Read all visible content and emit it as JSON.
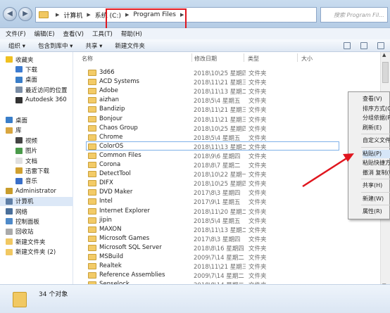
{
  "address": {
    "nav_back": "◀",
    "nav_fwd": "▶",
    "crumbs": [
      "计算机",
      "系统 (C:)",
      "Program Files"
    ],
    "search_placeholder": "搜索 Program Fil..."
  },
  "menubar": [
    "文件(F)",
    "编辑(E)",
    "查看(V)",
    "工具(T)",
    "帮助(H)"
  ],
  "toolbar": [
    "组织 ▾",
    "包含到库中 ▾",
    "共享 ▾",
    "新建文件夹"
  ],
  "sidebar": [
    {
      "label": "收藏夹",
      "icon": "star-icon",
      "indent": 1
    },
    {
      "label": "下载",
      "icon": "download-icon",
      "indent": 2
    },
    {
      "label": "桌面",
      "icon": "desktop-icon",
      "indent": 2
    },
    {
      "label": "最近访问的位置",
      "icon": "recent-icon",
      "indent": 2
    },
    {
      "label": "Autodesk 360",
      "icon": "cloud-icon",
      "indent": 2
    },
    {
      "label": "",
      "icon": "",
      "indent": 0
    },
    {
      "label": "桌面",
      "icon": "desktop-icon",
      "indent": 1
    },
    {
      "label": "库",
      "icon": "library-icon",
      "indent": 1
    },
    {
      "label": "视频",
      "icon": "video-icon",
      "indent": 2
    },
    {
      "label": "图片",
      "icon": "picture-icon",
      "indent": 2
    },
    {
      "label": "文档",
      "icon": "document-icon",
      "indent": 2
    },
    {
      "label": "迅雷下载",
      "icon": "thunder-icon",
      "indent": 2
    },
    {
      "label": "音乐",
      "icon": "music-icon",
      "indent": 2
    },
    {
      "label": "Administrator",
      "icon": "user-icon",
      "indent": 1
    },
    {
      "label": "计算机",
      "icon": "computer-icon",
      "indent": 1
    },
    {
      "label": "网络",
      "icon": "network-icon",
      "indent": 1
    },
    {
      "label": "控制面板",
      "icon": "control-panel-icon",
      "indent": 1
    },
    {
      "label": "回收站",
      "icon": "recycle-bin-icon",
      "indent": 1
    },
    {
      "label": "新建文件夹",
      "icon": "folder-icon",
      "indent": 1
    },
    {
      "label": "新建文件夹 (2)",
      "icon": "folder-icon",
      "indent": 1
    }
  ],
  "sidebar_selected": 14,
  "columns": [
    "名称",
    "修改日期",
    "类型",
    "大小"
  ],
  "files": [
    {
      "name": "3d66",
      "date": "2018\\10\\25 星期四",
      "type": "文件夹"
    },
    {
      "name": "ACD Systems",
      "date": "2018\\11\\21 星期三",
      "type": "文件夹"
    },
    {
      "name": "Adobe",
      "date": "2018\\11\\13 星期二",
      "type": "文件夹"
    },
    {
      "name": "aizhan",
      "date": "2018\\5\\4 星期五",
      "type": "文件夹"
    },
    {
      "name": "Bandizip",
      "date": "2018\\11\\21 星期三",
      "type": "文件夹"
    },
    {
      "name": "Bonjour",
      "date": "2018\\11\\21 星期三",
      "type": "文件夹"
    },
    {
      "name": "Chaos Group",
      "date": "2018\\10\\25 星期四",
      "type": "文件夹"
    },
    {
      "name": "Chrome",
      "date": "2018\\5\\4 星期五",
      "type": "文件夹"
    },
    {
      "name": "ColorOS",
      "date": "2018\\11\\13 星期二",
      "type": "文件夹"
    },
    {
      "name": "Common Files",
      "date": "2018\\9\\6 星期四",
      "type": "文件夹"
    },
    {
      "name": "Corona",
      "date": "2018\\8\\7 星期二",
      "type": "文件夹"
    },
    {
      "name": "DetectTool",
      "date": "2018\\10\\22 星期一",
      "type": "文件夹"
    },
    {
      "name": "DIFX",
      "date": "2018\\10\\25 星期四",
      "type": "文件夹"
    },
    {
      "name": "DVD Maker",
      "date": "2017\\8\\3 星期四",
      "type": "文件夹"
    },
    {
      "name": "Intel",
      "date": "2017\\9\\1 星期五",
      "type": "文件夹"
    },
    {
      "name": "Internet Explorer",
      "date": "2018\\11\\20 星期二",
      "type": "文件夹"
    },
    {
      "name": "jipin",
      "date": "2018\\5\\4 星期五",
      "type": "文件夹"
    },
    {
      "name": "MAXON",
      "date": "2018\\11\\13 星期二",
      "type": "文件夹"
    },
    {
      "name": "Microsoft Games",
      "date": "2017\\8\\3 星期四",
      "type": "文件夹"
    },
    {
      "name": "Microsoft SQL Server",
      "date": "2018\\8\\16 星期四",
      "type": "文件夹"
    },
    {
      "name": "MSBuild",
      "date": "2009\\7\\14 星期二",
      "type": "文件夹"
    },
    {
      "name": "Realtek",
      "date": "2018\\11\\21 星期三",
      "type": "文件夹"
    },
    {
      "name": "Reference Assemblies",
      "date": "2009\\7\\14 星期二",
      "type": "文件夹"
    },
    {
      "name": "Senselock",
      "date": "2018\\8\\14 星期二",
      "type": "文件夹"
    }
  ],
  "selected_file": 8,
  "context_menu": [
    {
      "label": "查看(V)",
      "sep_after": false
    },
    {
      "label": "排序方式(O)",
      "sep_after": false
    },
    {
      "label": "分组依据(P)",
      "sep_after": false
    },
    {
      "label": "刷新(E)",
      "sep_after": true
    },
    {
      "label": "自定义文件夹...",
      "sep_after": true
    },
    {
      "label": "粘贴(P)",
      "sep_after": false
    },
    {
      "label": "粘贴快捷方式(S)",
      "sep_after": false
    },
    {
      "label": "撤消 复制(U)",
      "sep_after": true
    },
    {
      "label": "共享(H)",
      "sep_after": true
    },
    {
      "label": "新建(W)",
      "sep_after": true
    },
    {
      "label": "属性(R)",
      "sep_after": false
    }
  ],
  "context_hover": 5,
  "status": {
    "count": "34 个对象"
  },
  "colors": {
    "highlight": "#e0161e",
    "selection": "#7fb1e8",
    "folder": "#f3cb67"
  }
}
